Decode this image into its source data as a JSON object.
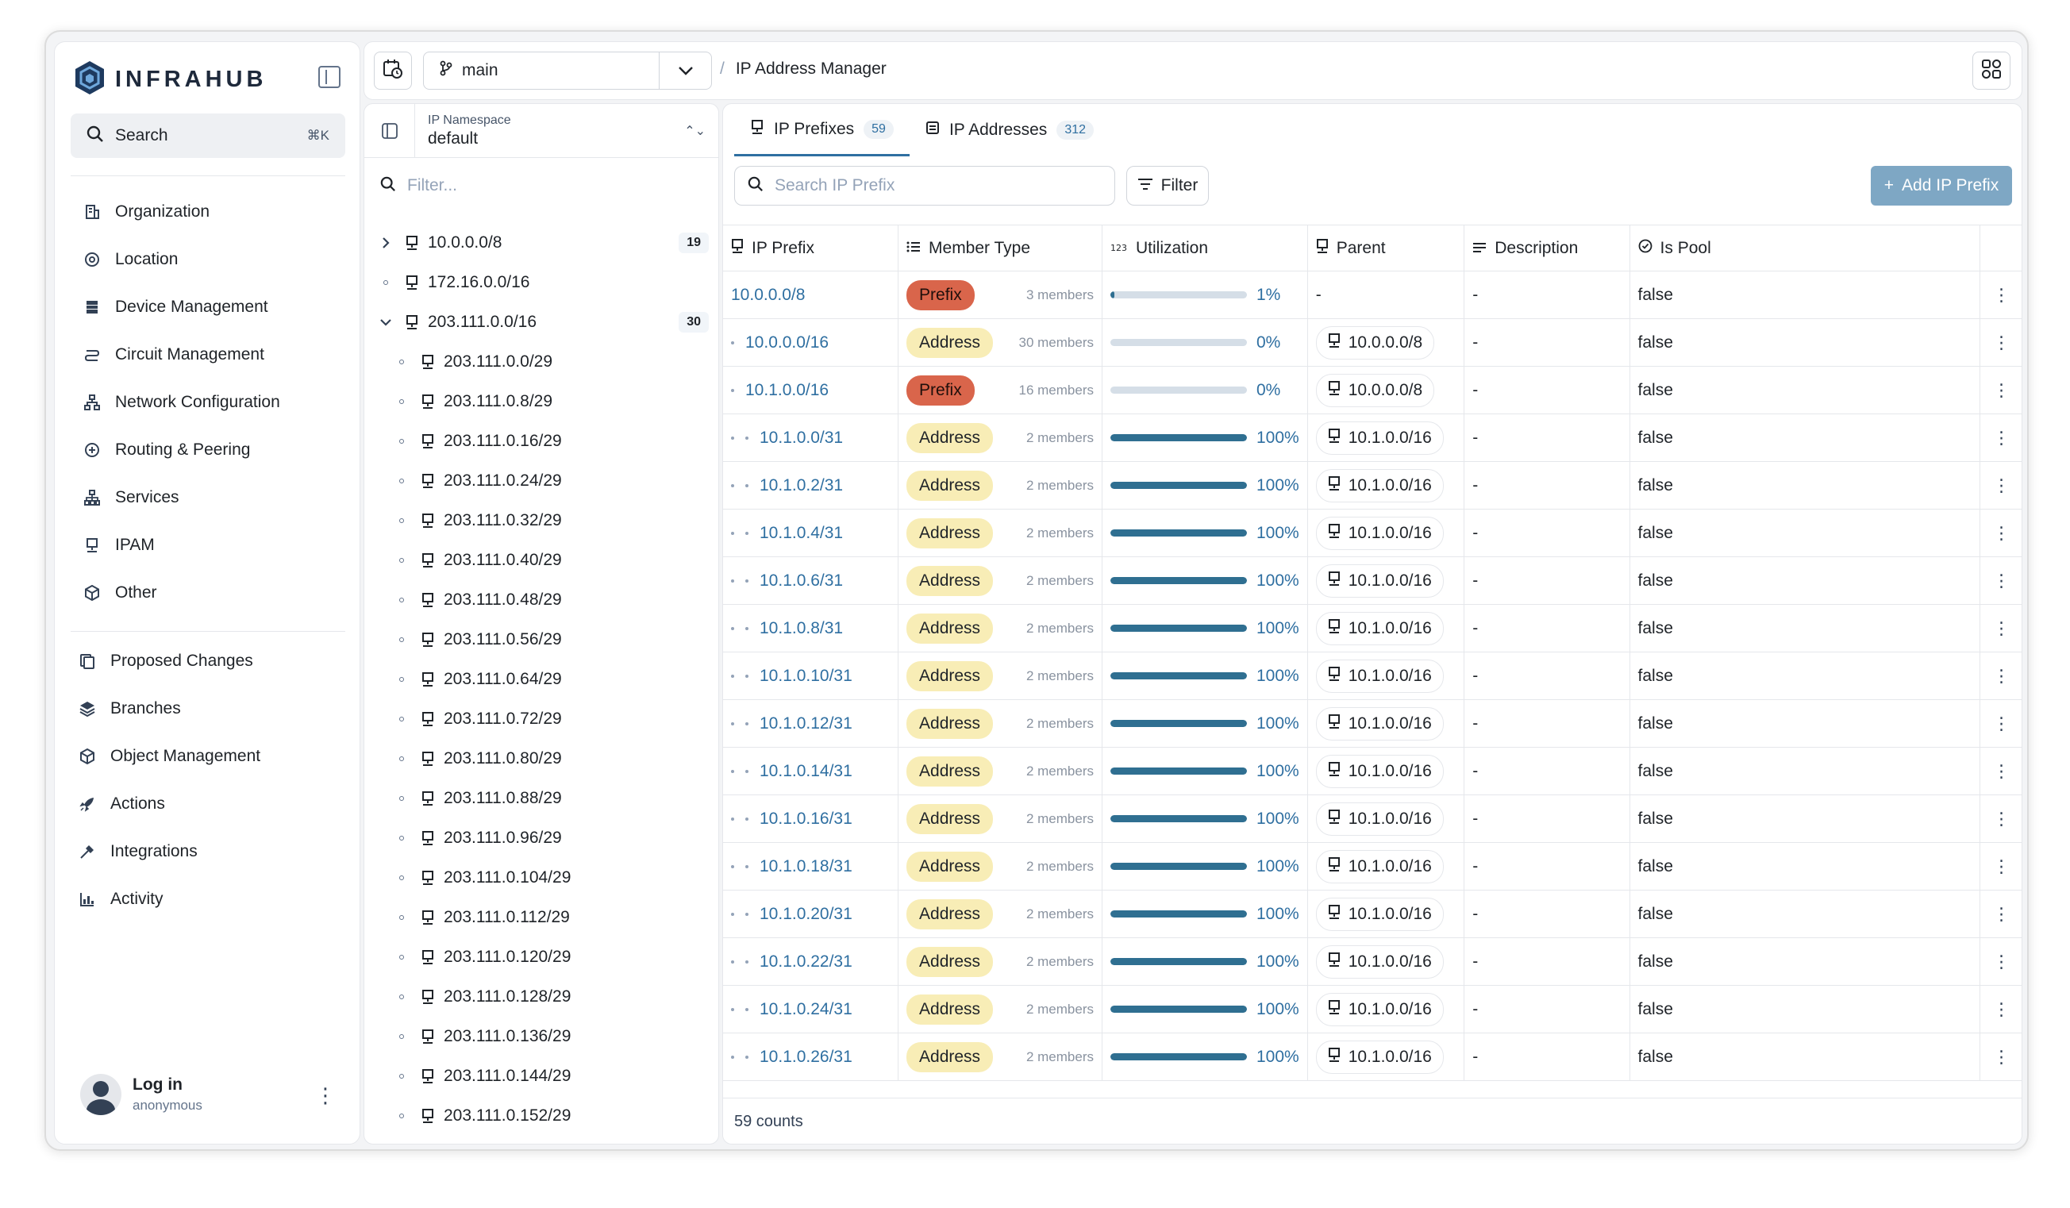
{
  "app": {
    "name": "INFRAHUB"
  },
  "search": {
    "label": "Search",
    "shortcut": "⌘K"
  },
  "nav_primary": [
    {
      "label": "Organization",
      "icon": "building-icon"
    },
    {
      "label": "Location",
      "icon": "location-icon"
    },
    {
      "label": "Device Management",
      "icon": "server-icon"
    },
    {
      "label": "Circuit Management",
      "icon": "circuit-icon"
    },
    {
      "label": "Network Configuration",
      "icon": "network-icon"
    },
    {
      "label": "Routing & Peering",
      "icon": "routing-icon"
    },
    {
      "label": "Services",
      "icon": "services-icon"
    },
    {
      "label": "IPAM",
      "icon": "ipam-icon"
    },
    {
      "label": "Other",
      "icon": "cube-icon"
    }
  ],
  "nav_secondary": [
    {
      "label": "Proposed Changes",
      "icon": "proposed-changes-icon"
    },
    {
      "label": "Branches",
      "icon": "layers-icon"
    },
    {
      "label": "Object Management",
      "icon": "cube-icon"
    },
    {
      "label": "Actions",
      "icon": "rocket-icon"
    },
    {
      "label": "Integrations",
      "icon": "plug-icon"
    },
    {
      "label": "Activity",
      "icon": "activity-icon"
    }
  ],
  "user": {
    "name": "Log in",
    "role": "anonymous"
  },
  "topbar": {
    "branch": "main",
    "breadcrumb": "IP Address Manager"
  },
  "namespace": {
    "label": "IP Namespace",
    "value": "default",
    "filter_placeholder": "Filter..."
  },
  "tree": [
    {
      "label": "10.0.0.0/8",
      "count": "19",
      "toggle": "collapsed",
      "depth": 0
    },
    {
      "label": "172.16.0.0/16",
      "count": "",
      "toggle": "leaf",
      "depth": 0
    },
    {
      "label": "203.111.0.0/16",
      "count": "30",
      "toggle": "expanded",
      "depth": 0
    },
    {
      "label": "203.111.0.0/29",
      "count": "",
      "toggle": "leaf",
      "depth": 1
    },
    {
      "label": "203.111.0.8/29",
      "count": "",
      "toggle": "leaf",
      "depth": 1
    },
    {
      "label": "203.111.0.16/29",
      "count": "",
      "toggle": "leaf",
      "depth": 1
    },
    {
      "label": "203.111.0.24/29",
      "count": "",
      "toggle": "leaf",
      "depth": 1
    },
    {
      "label": "203.111.0.32/29",
      "count": "",
      "toggle": "leaf",
      "depth": 1
    },
    {
      "label": "203.111.0.40/29",
      "count": "",
      "toggle": "leaf",
      "depth": 1
    },
    {
      "label": "203.111.0.48/29",
      "count": "",
      "toggle": "leaf",
      "depth": 1
    },
    {
      "label": "203.111.0.56/29",
      "count": "",
      "toggle": "leaf",
      "depth": 1
    },
    {
      "label": "203.111.0.64/29",
      "count": "",
      "toggle": "leaf",
      "depth": 1
    },
    {
      "label": "203.111.0.72/29",
      "count": "",
      "toggle": "leaf",
      "depth": 1
    },
    {
      "label": "203.111.0.80/29",
      "count": "",
      "toggle": "leaf",
      "depth": 1
    },
    {
      "label": "203.111.0.88/29",
      "count": "",
      "toggle": "leaf",
      "depth": 1
    },
    {
      "label": "203.111.0.96/29",
      "count": "",
      "toggle": "leaf",
      "depth": 1
    },
    {
      "label": "203.111.0.104/29",
      "count": "",
      "toggle": "leaf",
      "depth": 1
    },
    {
      "label": "203.111.0.112/29",
      "count": "",
      "toggle": "leaf",
      "depth": 1
    },
    {
      "label": "203.111.0.120/29",
      "count": "",
      "toggle": "leaf",
      "depth": 1
    },
    {
      "label": "203.111.0.128/29",
      "count": "",
      "toggle": "leaf",
      "depth": 1
    },
    {
      "label": "203.111.0.136/29",
      "count": "",
      "toggle": "leaf",
      "depth": 1
    },
    {
      "label": "203.111.0.144/29",
      "count": "",
      "toggle": "leaf",
      "depth": 1
    },
    {
      "label": "203.111.0.152/29",
      "count": "",
      "toggle": "leaf",
      "depth": 1
    }
  ],
  "tabs": [
    {
      "label": "IP Prefixes",
      "count": "59",
      "active": true
    },
    {
      "label": "IP Addresses",
      "count": "312",
      "active": false
    }
  ],
  "toolbar": {
    "search_placeholder": "Search IP Prefix",
    "filter_label": "Filter",
    "add_label": "Add IP Prefix"
  },
  "columns": [
    "IP Prefix",
    "Member Type",
    "Utilization",
    "Parent",
    "Description",
    "Is Pool"
  ],
  "rows": [
    {
      "prefix": "10.0.0.0/8",
      "depth": 0,
      "member_type": "Prefix",
      "members": "3 members",
      "util": 1,
      "util_label": "1%",
      "parent": "-",
      "description": "-",
      "is_pool": "false"
    },
    {
      "prefix": "10.0.0.0/16",
      "depth": 1,
      "member_type": "Address",
      "members": "30 members",
      "util": 0,
      "util_label": "0%",
      "parent": "10.0.0.0/8",
      "description": "-",
      "is_pool": "false"
    },
    {
      "prefix": "10.1.0.0/16",
      "depth": 1,
      "member_type": "Prefix",
      "members": "16 members",
      "util": 0,
      "util_label": "0%",
      "parent": "10.0.0.0/8",
      "description": "-",
      "is_pool": "false"
    },
    {
      "prefix": "10.1.0.0/31",
      "depth": 2,
      "member_type": "Address",
      "members": "2 members",
      "util": 100,
      "util_label": "100%",
      "parent": "10.1.0.0/16",
      "description": "-",
      "is_pool": "false"
    },
    {
      "prefix": "10.1.0.2/31",
      "depth": 2,
      "member_type": "Address",
      "members": "2 members",
      "util": 100,
      "util_label": "100%",
      "parent": "10.1.0.0/16",
      "description": "-",
      "is_pool": "false"
    },
    {
      "prefix": "10.1.0.4/31",
      "depth": 2,
      "member_type": "Address",
      "members": "2 members",
      "util": 100,
      "util_label": "100%",
      "parent": "10.1.0.0/16",
      "description": "-",
      "is_pool": "false"
    },
    {
      "prefix": "10.1.0.6/31",
      "depth": 2,
      "member_type": "Address",
      "members": "2 members",
      "util": 100,
      "util_label": "100%",
      "parent": "10.1.0.0/16",
      "description": "-",
      "is_pool": "false"
    },
    {
      "prefix": "10.1.0.8/31",
      "depth": 2,
      "member_type": "Address",
      "members": "2 members",
      "util": 100,
      "util_label": "100%",
      "parent": "10.1.0.0/16",
      "description": "-",
      "is_pool": "false"
    },
    {
      "prefix": "10.1.0.10/31",
      "depth": 2,
      "member_type": "Address",
      "members": "2 members",
      "util": 100,
      "util_label": "100%",
      "parent": "10.1.0.0/16",
      "description": "-",
      "is_pool": "false"
    },
    {
      "prefix": "10.1.0.12/31",
      "depth": 2,
      "member_type": "Address",
      "members": "2 members",
      "util": 100,
      "util_label": "100%",
      "parent": "10.1.0.0/16",
      "description": "-",
      "is_pool": "false"
    },
    {
      "prefix": "10.1.0.14/31",
      "depth": 2,
      "member_type": "Address",
      "members": "2 members",
      "util": 100,
      "util_label": "100%",
      "parent": "10.1.0.0/16",
      "description": "-",
      "is_pool": "false"
    },
    {
      "prefix": "10.1.0.16/31",
      "depth": 2,
      "member_type": "Address",
      "members": "2 members",
      "util": 100,
      "util_label": "100%",
      "parent": "10.1.0.0/16",
      "description": "-",
      "is_pool": "false"
    },
    {
      "prefix": "10.1.0.18/31",
      "depth": 2,
      "member_type": "Address",
      "members": "2 members",
      "util": 100,
      "util_label": "100%",
      "parent": "10.1.0.0/16",
      "description": "-",
      "is_pool": "false"
    },
    {
      "prefix": "10.1.0.20/31",
      "depth": 2,
      "member_type": "Address",
      "members": "2 members",
      "util": 100,
      "util_label": "100%",
      "parent": "10.1.0.0/16",
      "description": "-",
      "is_pool": "false"
    },
    {
      "prefix": "10.1.0.22/31",
      "depth": 2,
      "member_type": "Address",
      "members": "2 members",
      "util": 100,
      "util_label": "100%",
      "parent": "10.1.0.0/16",
      "description": "-",
      "is_pool": "false"
    },
    {
      "prefix": "10.1.0.24/31",
      "depth": 2,
      "member_type": "Address",
      "members": "2 members",
      "util": 100,
      "util_label": "100%",
      "parent": "10.1.0.0/16",
      "description": "-",
      "is_pool": "false"
    },
    {
      "prefix": "10.1.0.26/31",
      "depth": 2,
      "member_type": "Address",
      "members": "2 members",
      "util": 100,
      "util_label": "100%",
      "parent": "10.1.0.0/16",
      "description": "-",
      "is_pool": "false"
    }
  ],
  "footer": {
    "count_label": "59 counts"
  },
  "colors": {
    "accent": "#2f6fa1",
    "prefix_pill": "#d9654b",
    "address_pill": "#f8edb6",
    "bar_fill": "#2f6f91",
    "add_button": "#7ea7c4"
  }
}
